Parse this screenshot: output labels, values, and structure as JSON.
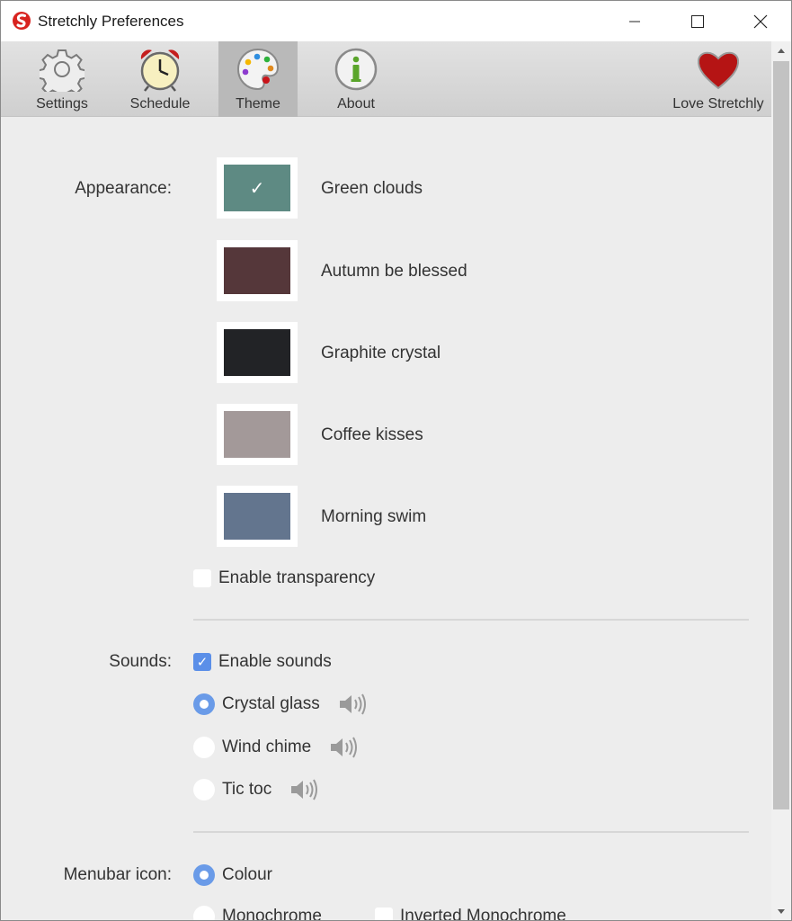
{
  "window": {
    "title": "Stretchly Preferences"
  },
  "toolbar": {
    "settings": "Settings",
    "schedule": "Schedule",
    "theme": "Theme",
    "about": "About",
    "love": "Love Stretchly"
  },
  "appearance": {
    "label": "Appearance:",
    "themes": [
      {
        "name": "Green clouds",
        "color": "#5e8a83",
        "selected": true
      },
      {
        "name": "Autumn be blessed",
        "color": "#55373a",
        "selected": false
      },
      {
        "name": "Graphite crystal",
        "color": "#222326",
        "selected": false
      },
      {
        "name": "Coffee kisses",
        "color": "#a39999",
        "selected": false
      },
      {
        "name": "Morning swim",
        "color": "#63758e",
        "selected": false
      }
    ],
    "check_mark": "✓",
    "transparency": {
      "label": "Enable transparency",
      "checked": false
    }
  },
  "sounds": {
    "label": "Sounds:",
    "enable": {
      "label": "Enable sounds",
      "checked": true,
      "mark": "✓"
    },
    "options": [
      {
        "label": "Crystal glass",
        "selected": true
      },
      {
        "label": "Wind chime",
        "selected": false
      },
      {
        "label": "Tic toc",
        "selected": false
      }
    ]
  },
  "menubar": {
    "label": "Menubar icon:",
    "colour": {
      "label": "Colour",
      "selected": true
    },
    "monochrome": {
      "label": "Monochrome",
      "selected": false
    },
    "inverted": {
      "label": "Inverted Monochrome",
      "checked": false
    }
  }
}
